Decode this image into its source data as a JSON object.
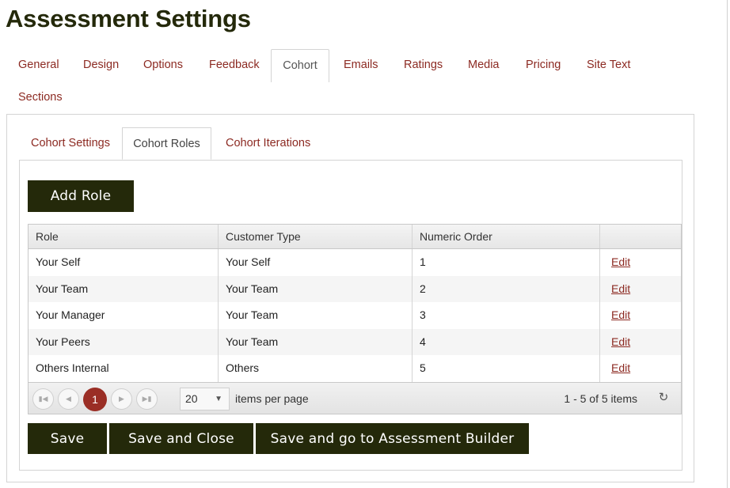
{
  "page_title": "Assessment Settings",
  "main_tabs": [
    {
      "label": "General"
    },
    {
      "label": "Design"
    },
    {
      "label": "Options"
    },
    {
      "label": "Feedback"
    },
    {
      "label": "Cohort",
      "active": true
    },
    {
      "label": "Emails"
    },
    {
      "label": "Ratings"
    },
    {
      "label": "Media"
    },
    {
      "label": "Pricing"
    },
    {
      "label": "Site Text"
    },
    {
      "label": "Sections"
    }
  ],
  "sub_tabs": [
    {
      "label": "Cohort Settings"
    },
    {
      "label": "Cohort Roles",
      "active": true
    },
    {
      "label": "Cohort Iterations"
    }
  ],
  "add_role_label": "Add Role",
  "grid": {
    "columns": [
      "Role",
      "Customer Type",
      "Numeric Order",
      ""
    ],
    "rows": [
      {
        "role": "Your Self",
        "customer_type": "Your Self",
        "order": "1",
        "action": "Edit"
      },
      {
        "role": "Your Team",
        "customer_type": "Your Team",
        "order": "2",
        "action": "Edit"
      },
      {
        "role": "Your Manager",
        "customer_type": "Your Team",
        "order": "3",
        "action": "Edit"
      },
      {
        "role": "Your Peers",
        "customer_type": "Your Team",
        "order": "4",
        "action": "Edit"
      },
      {
        "role": "Others Internal",
        "customer_type": "Others",
        "order": "5",
        "action": "Edit"
      }
    ]
  },
  "pager": {
    "current_page": "1",
    "page_size": "20",
    "items_per_page_label": "items per page",
    "info": "1 - 5 of 5 items"
  },
  "buttons": {
    "save": "Save",
    "save_close": "Save and Close",
    "save_builder": "Save and go to Assessment Builder"
  },
  "colors": {
    "accent_dark": "#24290a",
    "link": "#8c2a22",
    "page_active": "#9a2e25"
  }
}
